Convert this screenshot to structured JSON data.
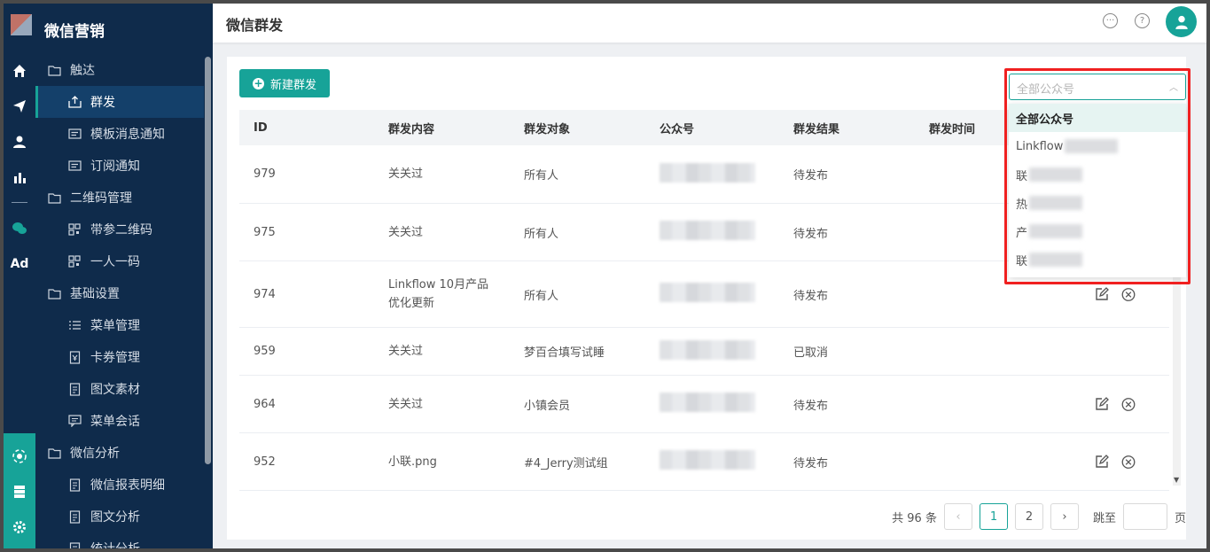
{
  "app": {
    "brand": "微信营销",
    "page_title": "微信群发"
  },
  "sidebar": {
    "items": [
      {
        "label": "触达",
        "type": "group",
        "icon": "folder-icon"
      },
      {
        "label": "群发",
        "type": "child",
        "icon": "share-icon",
        "active": true
      },
      {
        "label": "模板消息通知",
        "type": "child",
        "icon": "template-icon"
      },
      {
        "label": "订阅通知",
        "type": "child",
        "icon": "template-icon"
      },
      {
        "label": "二维码管理",
        "type": "group",
        "icon": "folder-icon"
      },
      {
        "label": "带参二维码",
        "type": "child",
        "icon": "qrcode-icon"
      },
      {
        "label": "一人一码",
        "type": "child",
        "icon": "qrcode-icon"
      },
      {
        "label": "基础设置",
        "type": "group",
        "icon": "folder-icon"
      },
      {
        "label": "菜单管理",
        "type": "child",
        "icon": "list-icon"
      },
      {
        "label": "卡券管理",
        "type": "child",
        "icon": "coupon-icon"
      },
      {
        "label": "图文素材",
        "type": "child",
        "icon": "document-icon"
      },
      {
        "label": "菜单会话",
        "type": "child",
        "icon": "chat-icon"
      },
      {
        "label": "微信分析",
        "type": "group",
        "icon": "folder-icon"
      },
      {
        "label": "微信报表明细",
        "type": "child",
        "icon": "document-icon"
      },
      {
        "label": "图文分析",
        "type": "child",
        "icon": "document-icon"
      },
      {
        "label": "统计分析",
        "type": "child",
        "icon": "document-icon"
      }
    ]
  },
  "rail": {
    "ad_label": "Ad"
  },
  "toolbar": {
    "new_button": "新建群发"
  },
  "filter": {
    "placeholder": "全部公众号",
    "options": [
      {
        "label": "全部公众号",
        "selected": true
      },
      {
        "label": "Linkflow"
      },
      {
        "label": "联"
      },
      {
        "label": "热"
      },
      {
        "label": "产"
      },
      {
        "label": "联"
      }
    ]
  },
  "table": {
    "headers": [
      "ID",
      "群发内容",
      "群发对象",
      "公众号",
      "群发结果",
      "群发时间"
    ],
    "rows": [
      {
        "id": "979",
        "content": "关关过",
        "target": "所有人",
        "result": "待发布",
        "actions": false
      },
      {
        "id": "975",
        "content": "关关过",
        "target": "所有人",
        "result": "待发布",
        "actions": false
      },
      {
        "id": "974",
        "content": "Linkflow 10月产品优化更新",
        "target": "所有人",
        "result": "待发布",
        "actions": true
      },
      {
        "id": "959",
        "content": "关关过",
        "target": "梦百合填写试睡",
        "result": "已取消",
        "actions": false
      },
      {
        "id": "964",
        "content": "关关过",
        "target": "小镇会员",
        "result": "待发布",
        "actions": true
      },
      {
        "id": "952",
        "content": "小联.png",
        "target": "#4_Jerry测试组",
        "result": "待发布",
        "actions": true
      }
    ]
  },
  "pagination": {
    "total": "共 96 条",
    "pages": [
      "1",
      "2"
    ],
    "current": "1",
    "goto_label": "跳至",
    "page_suffix": "页"
  },
  "colors": {
    "accent": "#17a398",
    "sidebar_bg": "#0f2b4b",
    "highlight": "#f02020"
  }
}
